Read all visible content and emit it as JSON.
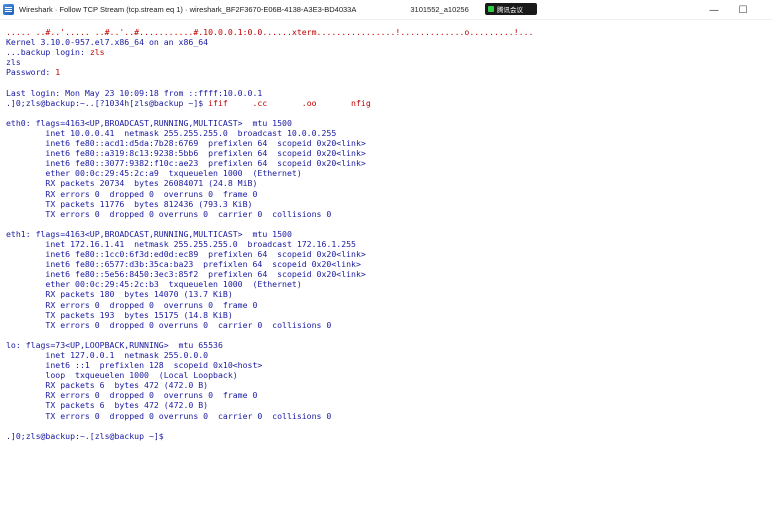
{
  "window": {
    "title": "Wireshark · Follow TCP Stream (tcp.stream eq 1) · wireshark_BF2F3670-E06B-4138-A3E3-BD4033A",
    "title_suffix": "3101552_a10256",
    "overlay_label": "腾讯会议",
    "minimize_glyph": "—",
    "maximize_glyph": "☐"
  },
  "stream_lines": [
    [
      {
        "t": "..... ..#..'..... ..#..'..#...........#.10.0.0.1:0.0......xterm................!.............o.........!...",
        "c": "red"
      }
    ],
    [
      {
        "t": "Kernel 3.10.0-957.el7.x86_64 on an x86_64",
        "c": "blue"
      }
    ],
    [
      {
        "t": "...backup login: ",
        "c": "blue"
      },
      {
        "t": "zls",
        "c": "red"
      }
    ],
    [
      {
        "t": "zls",
        "c": "blue"
      }
    ],
    [
      {
        "t": "Password: ",
        "c": "blue"
      },
      {
        "t": "1",
        "c": "red"
      }
    ],
    [
      {
        "t": "",
        "c": "blue"
      }
    ],
    [
      {
        "t": "Last login: Mon May 23 10:09:18 from ::ffff:10.0.0.1",
        "c": "blue"
      }
    ],
    [
      {
        "t": ".]0;zls@backup:~..[?1034h[zls@backup ~]$ ",
        "c": "blue"
      },
      {
        "t": "ifif     .cc       .oo       nfig",
        "c": "red"
      }
    ],
    [
      {
        "t": "",
        "c": "blue"
      }
    ],
    [
      {
        "t": "eth0: flags=4163<UP,BROADCAST,RUNNING,MULTICAST>  mtu 1500",
        "c": "blue"
      }
    ],
    [
      {
        "t": "        inet 10.0.0.41  netmask 255.255.255.0  broadcast 10.0.0.255",
        "c": "blue"
      }
    ],
    [
      {
        "t": "        inet6 fe80::acd1:d5da:7b28:6769  prefixlen 64  scopeid 0x20<link>",
        "c": "blue"
      }
    ],
    [
      {
        "t": "        inet6 fe80::a319:8c13:9238:5bb6  prefixlen 64  scopeid 0x20<link>",
        "c": "blue"
      }
    ],
    [
      {
        "t": "        inet6 fe80::3077:9382:f10c:ae23  prefixlen 64  scopeid 0x20<link>",
        "c": "blue"
      }
    ],
    [
      {
        "t": "        ether 00:0c:29:45:2c:a9  txqueuelen 1000  (Ethernet)",
        "c": "blue"
      }
    ],
    [
      {
        "t": "        RX packets 20734  bytes 26084071 (24.8 MiB)",
        "c": "blue"
      }
    ],
    [
      {
        "t": "        RX errors 0  dropped 0  overruns 0  frame 0",
        "c": "blue"
      }
    ],
    [
      {
        "t": "        TX packets 11776  bytes 812436 (793.3 KiB)",
        "c": "blue"
      }
    ],
    [
      {
        "t": "        TX errors 0  dropped 0 overruns 0  carrier 0  collisions 0",
        "c": "blue"
      }
    ],
    [
      {
        "t": "",
        "c": "blue"
      }
    ],
    [
      {
        "t": "eth1: flags=4163<UP,BROADCAST,RUNNING,MULTICAST>  mtu 1500",
        "c": "blue"
      }
    ],
    [
      {
        "t": "        inet 172.16.1.41  netmask 255.255.255.0  broadcast 172.16.1.255",
        "c": "blue"
      }
    ],
    [
      {
        "t": "        inet6 fe80::1cc0:6f3d:ed0d:ec89  prefixlen 64  scopeid 0x20<link>",
        "c": "blue"
      }
    ],
    [
      {
        "t": "        inet6 fe80::6577:d3b:35ca:ba23  prefixlen 64  scopeid 0x20<link>",
        "c": "blue"
      }
    ],
    [
      {
        "t": "        inet6 fe80::5e56:8450:3ec3:85f2  prefixlen 64  scopeid 0x20<link>",
        "c": "blue"
      }
    ],
    [
      {
        "t": "        ether 00:0c:29:45:2c:b3  txqueuelen 1000  (Ethernet)",
        "c": "blue"
      }
    ],
    [
      {
        "t": "        RX packets 180  bytes 14070 (13.7 KiB)",
        "c": "blue"
      }
    ],
    [
      {
        "t": "        RX errors 0  dropped 0  overruns 0  frame 0",
        "c": "blue"
      }
    ],
    [
      {
        "t": "        TX packets 193  bytes 15175 (14.8 KiB)",
        "c": "blue"
      }
    ],
    [
      {
        "t": "        TX errors 0  dropped 0 overruns 0  carrier 0  collisions 0",
        "c": "blue"
      }
    ],
    [
      {
        "t": "",
        "c": "blue"
      }
    ],
    [
      {
        "t": "lo: flags=73<UP,LOOPBACK,RUNNING>  mtu 65536",
        "c": "blue"
      }
    ],
    [
      {
        "t": "        inet 127.0.0.1  netmask 255.0.0.0",
        "c": "blue"
      }
    ],
    [
      {
        "t": "        inet6 ::1  prefixlen 128  scopeid 0x10<host>",
        "c": "blue"
      }
    ],
    [
      {
        "t": "        loop  txqueuelen 1000  (Local Loopback)",
        "c": "blue"
      }
    ],
    [
      {
        "t": "        RX packets 6  bytes 472 (472.0 B)",
        "c": "blue"
      }
    ],
    [
      {
        "t": "        RX errors 0  dropped 0  overruns 0  frame 0",
        "c": "blue"
      }
    ],
    [
      {
        "t": "        TX packets 6  bytes 472 (472.0 B)",
        "c": "blue"
      }
    ],
    [
      {
        "t": "        TX errors 0  dropped 0 overruns 0  carrier 0  collisions 0",
        "c": "blue"
      }
    ],
    [
      {
        "t": "",
        "c": "blue"
      }
    ],
    [
      {
        "t": ".]0;zls@backup:~.[zls@backup ~]$",
        "c": "blue"
      }
    ]
  ],
  "colors": {
    "client": "#c00000",
    "server": "#1a1aa0"
  }
}
